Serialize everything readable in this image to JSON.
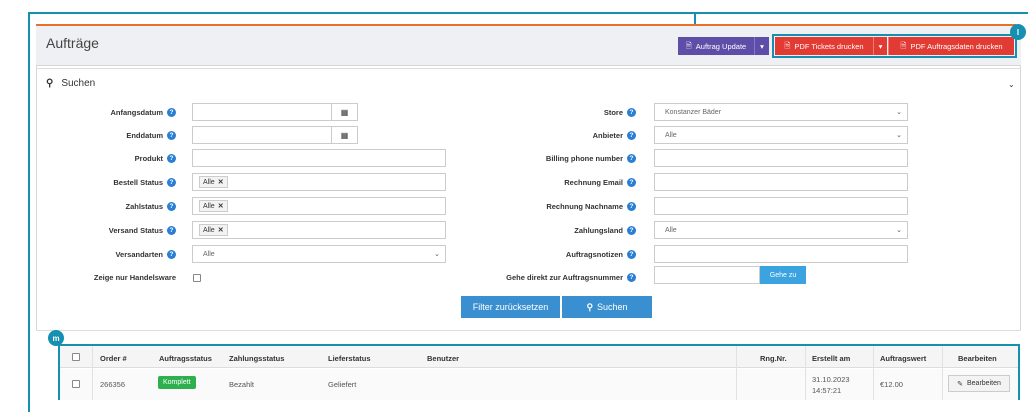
{
  "header": {
    "title": "Aufträge",
    "btn_update": "Auftrag Update",
    "btn_pdf_tickets": "PDF Tickets drucken",
    "btn_pdf_auftragsdaten": "PDF Auftragsdaten drucken"
  },
  "markers": {
    "l": "l",
    "m": "m"
  },
  "search": {
    "title": "Suchen",
    "left": [
      {
        "label": "Anfangsdatum"
      },
      {
        "label": "Enddatum"
      },
      {
        "label": "Produkt"
      },
      {
        "label": "Bestell Status",
        "tag": "Alle"
      },
      {
        "label": "Zahlstatus",
        "tag": "Alle"
      },
      {
        "label": "Versand Status",
        "tag": "Alle"
      },
      {
        "label": "Versandarten",
        "value": "Alle"
      },
      {
        "label": "Zeige nur Handelsware"
      }
    ],
    "right": [
      {
        "label": "Store",
        "value": "Konstanzer Bäder"
      },
      {
        "label": "Anbieter",
        "value": "Alle"
      },
      {
        "label": "Billing phone number"
      },
      {
        "label": "Rechnung Email"
      },
      {
        "label": "Rechnung Nachname"
      },
      {
        "label": "Zahlungsland",
        "value": "Alle"
      },
      {
        "label": "Auftragsnotizen"
      },
      {
        "label": "Gehe direkt zur Auftragsnummer",
        "button": "Gehe zu"
      }
    ],
    "btn_reset": "Filter zurücksetzen",
    "btn_search": "Suchen"
  },
  "table": {
    "columns": [
      "Order #",
      "Auftragsstatus",
      "Zahlungsstatus",
      "Lieferstatus",
      "Benutzer",
      "Rng.Nr.",
      "Erstellt am",
      "Auftragswert",
      "Bearbeiten"
    ],
    "rows": [
      {
        "order": "266356",
        "auftragsstatus": "Komplett",
        "zahlungsstatus": "Bezahlt",
        "lieferstatus": "Geliefert",
        "benutzer": "",
        "rng": "",
        "erstellt_date": "31.10.2023",
        "erstellt_time": "14:57:21",
        "wert": "€12.00",
        "edit": "Bearbeiten"
      }
    ]
  },
  "colors": {
    "accent": "#1590b0",
    "purple": "#5f4ea8",
    "red": "#e23b33",
    "blue": "#2a7fd4",
    "green": "#2eb04f"
  }
}
